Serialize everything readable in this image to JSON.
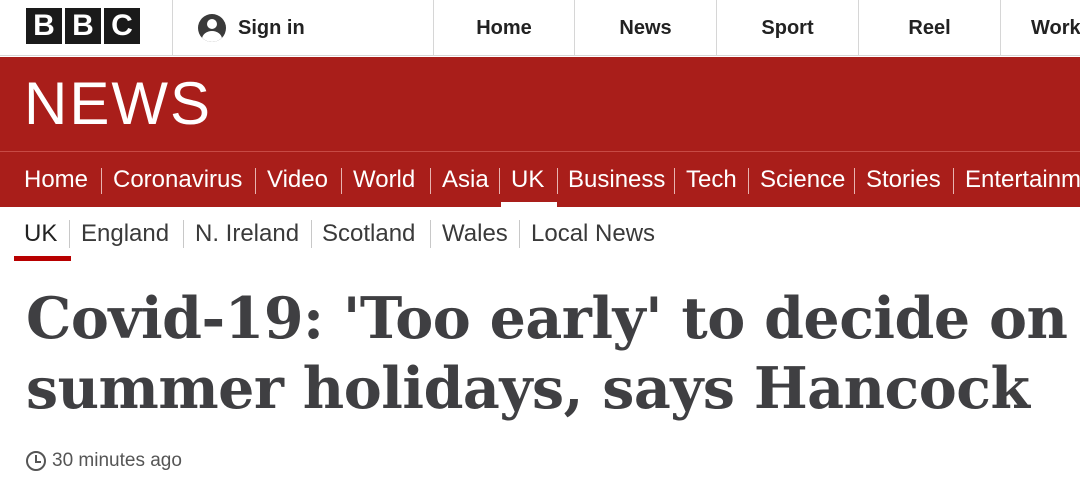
{
  "brand": {
    "letters": [
      "B",
      "B",
      "C"
    ]
  },
  "top_nav": {
    "signin_label": "Sign in",
    "items": [
      "Home",
      "News",
      "Sport",
      "Reel",
      "Work"
    ]
  },
  "news_banner": {
    "title": "NEWS"
  },
  "section_nav": {
    "items": [
      "Home",
      "Coronavirus",
      "Video",
      "World",
      "Asia",
      "UK",
      "Business",
      "Tech",
      "Science",
      "Stories",
      "Entertainm"
    ],
    "active": "UK"
  },
  "sub_nav": {
    "items": [
      "UK",
      "England",
      "N. Ireland",
      "Scotland",
      "Wales",
      "Local News"
    ],
    "active": "UK"
  },
  "article": {
    "headline_line1": "Covid-19: 'Too early' to decide on",
    "headline_line2": "summer holidays, says Hancock",
    "timestamp": "30 minutes ago"
  },
  "colors": {
    "brand_red": "#a91e1a",
    "active_underline": "#b80000",
    "headline_text": "#3f3f42"
  }
}
